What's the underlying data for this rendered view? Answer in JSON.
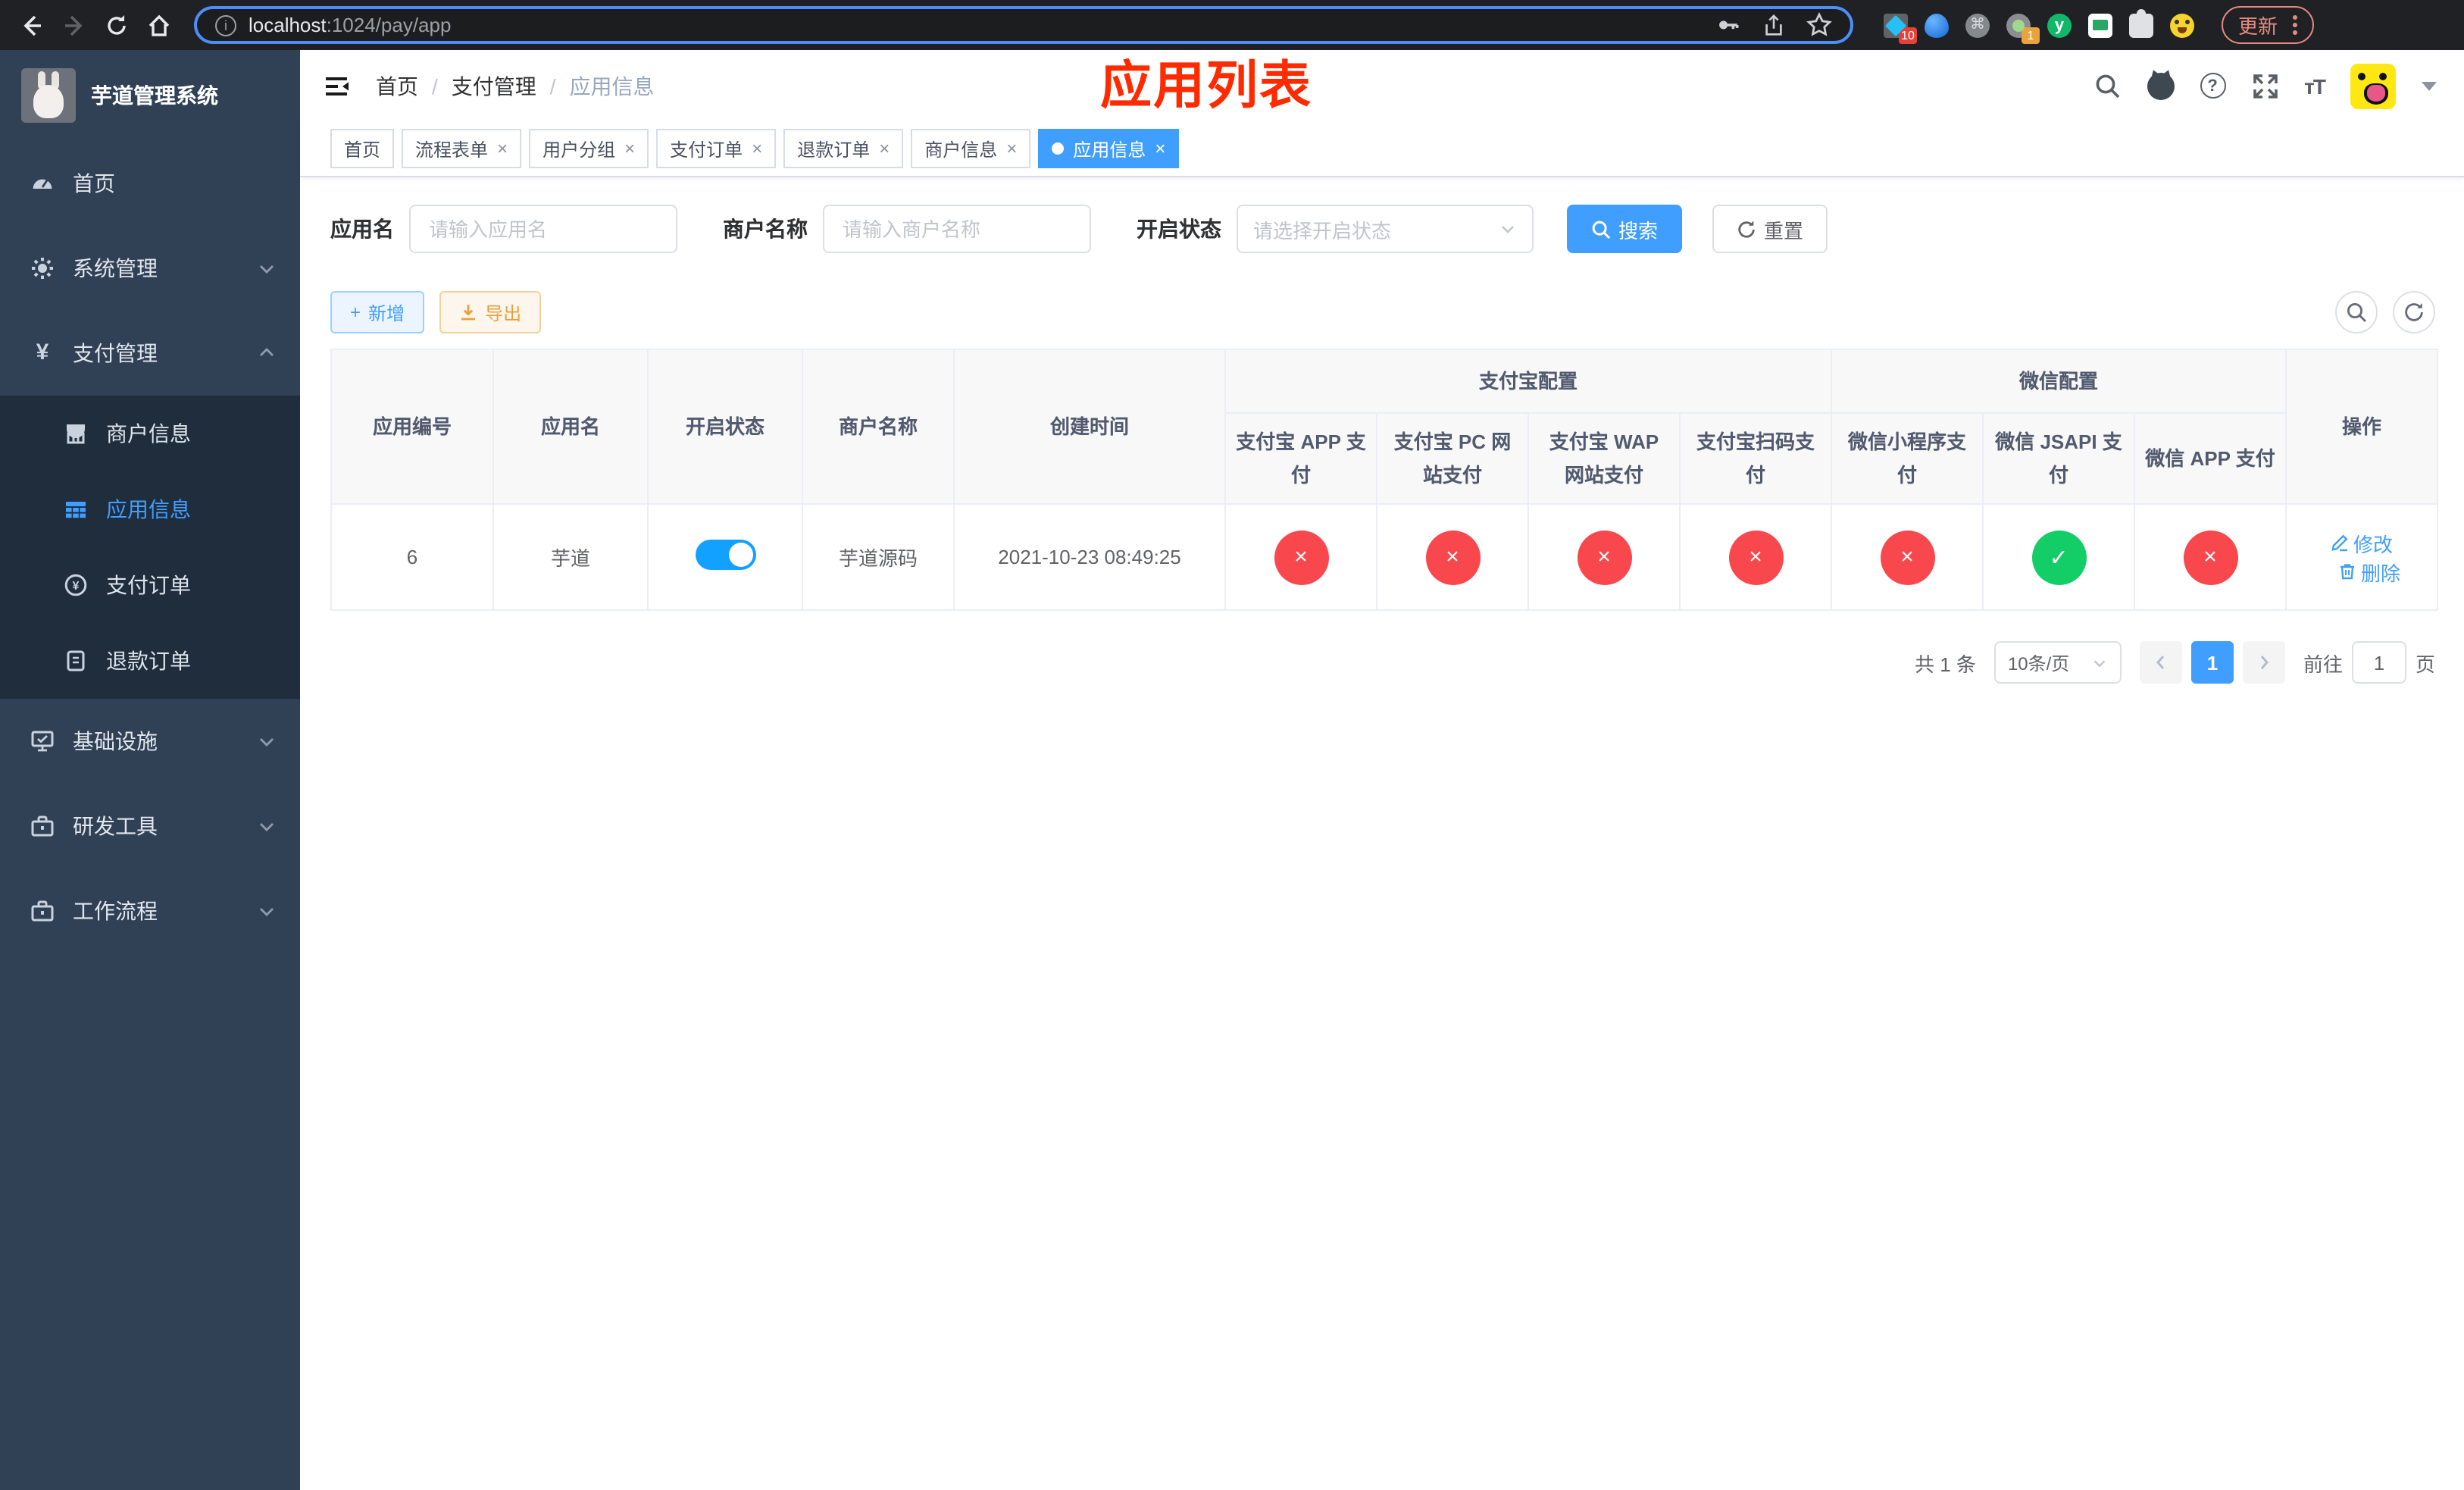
{
  "colors": {
    "accent": "#409eff",
    "danger": "#f8484e",
    "success": "#13ce66",
    "annotation": "#ff2b00"
  },
  "browser": {
    "url_host": "localhost",
    "url_rest": ":1024/pay/app",
    "ext_badge_grid": "10",
    "ext_badge_dot": "1",
    "ext_letter": "y",
    "update_label": "更新"
  },
  "sidebar": {
    "title": "芋道管理系统",
    "items": {
      "home": "首页",
      "system": "系统管理",
      "pay": "支付管理",
      "merchant": "商户信息",
      "app": "应用信息",
      "order": "支付订单",
      "refund": "退款订单",
      "infra": "基础设施",
      "dev": "研发工具",
      "flow": "工作流程"
    }
  },
  "header": {
    "breadcrumb": [
      "首页",
      "支付管理",
      "应用信息"
    ],
    "sep": "/",
    "annotation": "应用列表"
  },
  "tabs": {
    "close_glyph": "×",
    "items": [
      {
        "label": "首页"
      },
      {
        "label": "流程表单"
      },
      {
        "label": "用户分组"
      },
      {
        "label": "支付订单"
      },
      {
        "label": "退款订单"
      },
      {
        "label": "商户信息"
      },
      {
        "label": "应用信息"
      }
    ]
  },
  "filter": {
    "app_label": "应用名",
    "app_placeholder": "请输入应用名",
    "merchant_label": "商户名称",
    "merchant_placeholder": "请输入商户名称",
    "status_label": "开启状态",
    "status_placeholder": "请选择开启状态",
    "search_label": "搜索",
    "reset_label": "重置"
  },
  "toolbar": {
    "add_glyph": "+",
    "add_label": "新增",
    "export_label": "导出"
  },
  "table": {
    "headers": {
      "id": "应用编号",
      "name": "应用名",
      "status": "开启状态",
      "merchant": "商户名称",
      "created": "创建时间",
      "ops": "操作",
      "alipay_group": "支付宝配置",
      "wechat_group": "微信配置",
      "alipay_cols": [
        "支付宝 APP 支付",
        "支付宝 PC 网站支付",
        "支付宝 WAP 网站支付",
        "支付宝扫码支付"
      ],
      "wechat_cols": [
        "微信小程序支付",
        "微信 JSAPI 支付",
        "微信 APP 支付"
      ]
    },
    "row": {
      "id": "6",
      "name": "芋道",
      "enabled": true,
      "merchant": "芋道源码",
      "created": "2021-10-23 08:49:25",
      "cross": "×",
      "check": "✓",
      "edit": "修改",
      "delete": "删除"
    }
  },
  "pagination": {
    "total": "共 1 条",
    "size": "10条/页",
    "page": "1",
    "goto": "前往",
    "goto_value": "1",
    "unit": "页"
  }
}
